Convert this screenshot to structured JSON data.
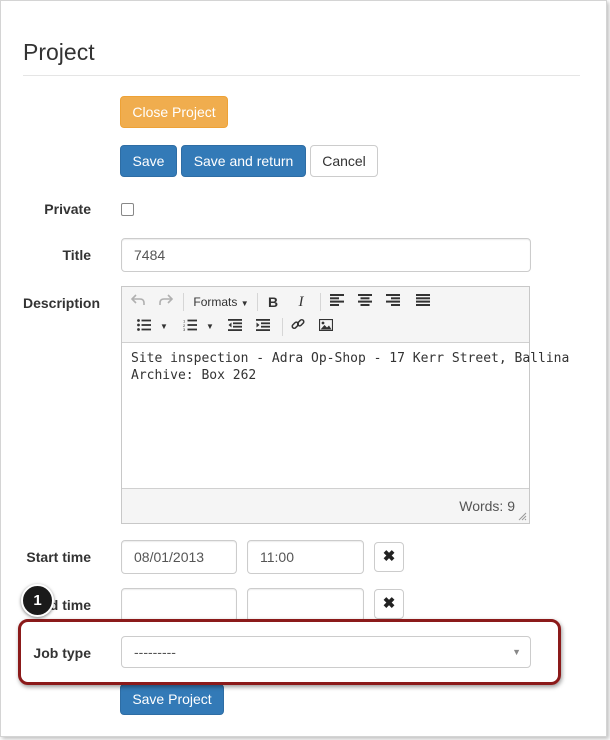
{
  "page": {
    "title": "Project"
  },
  "actions": {
    "close_project": "Close Project",
    "save": "Save",
    "save_and_return": "Save and return",
    "cancel": "Cancel",
    "save_project": "Save Project"
  },
  "form": {
    "private": {
      "label": "Private",
      "checked": false
    },
    "title": {
      "label": "Title",
      "value": "7484"
    },
    "description": {
      "label": "Description",
      "content_line1": "Site inspection - Adra Op-Shop - 17 Kerr Street, Ballina",
      "content_line2": "Archive: Box 262",
      "word_count": "Words: 9",
      "toolbar": {
        "formats_label": "Formats",
        "bold": "B",
        "italic": "I"
      }
    },
    "start_time": {
      "label": "Start time",
      "date": "08/01/2013",
      "time": "11:00"
    },
    "end_time": {
      "label": "End time",
      "visible_label": "d time",
      "date": "",
      "time": ""
    },
    "job_type": {
      "label": "Job type",
      "selected": "---------"
    }
  },
  "annotation": {
    "marker_number": "1",
    "highlight_color": "#8b1a1a"
  },
  "colors": {
    "primary": "#337ab7",
    "warning": "#f0ad4e"
  }
}
